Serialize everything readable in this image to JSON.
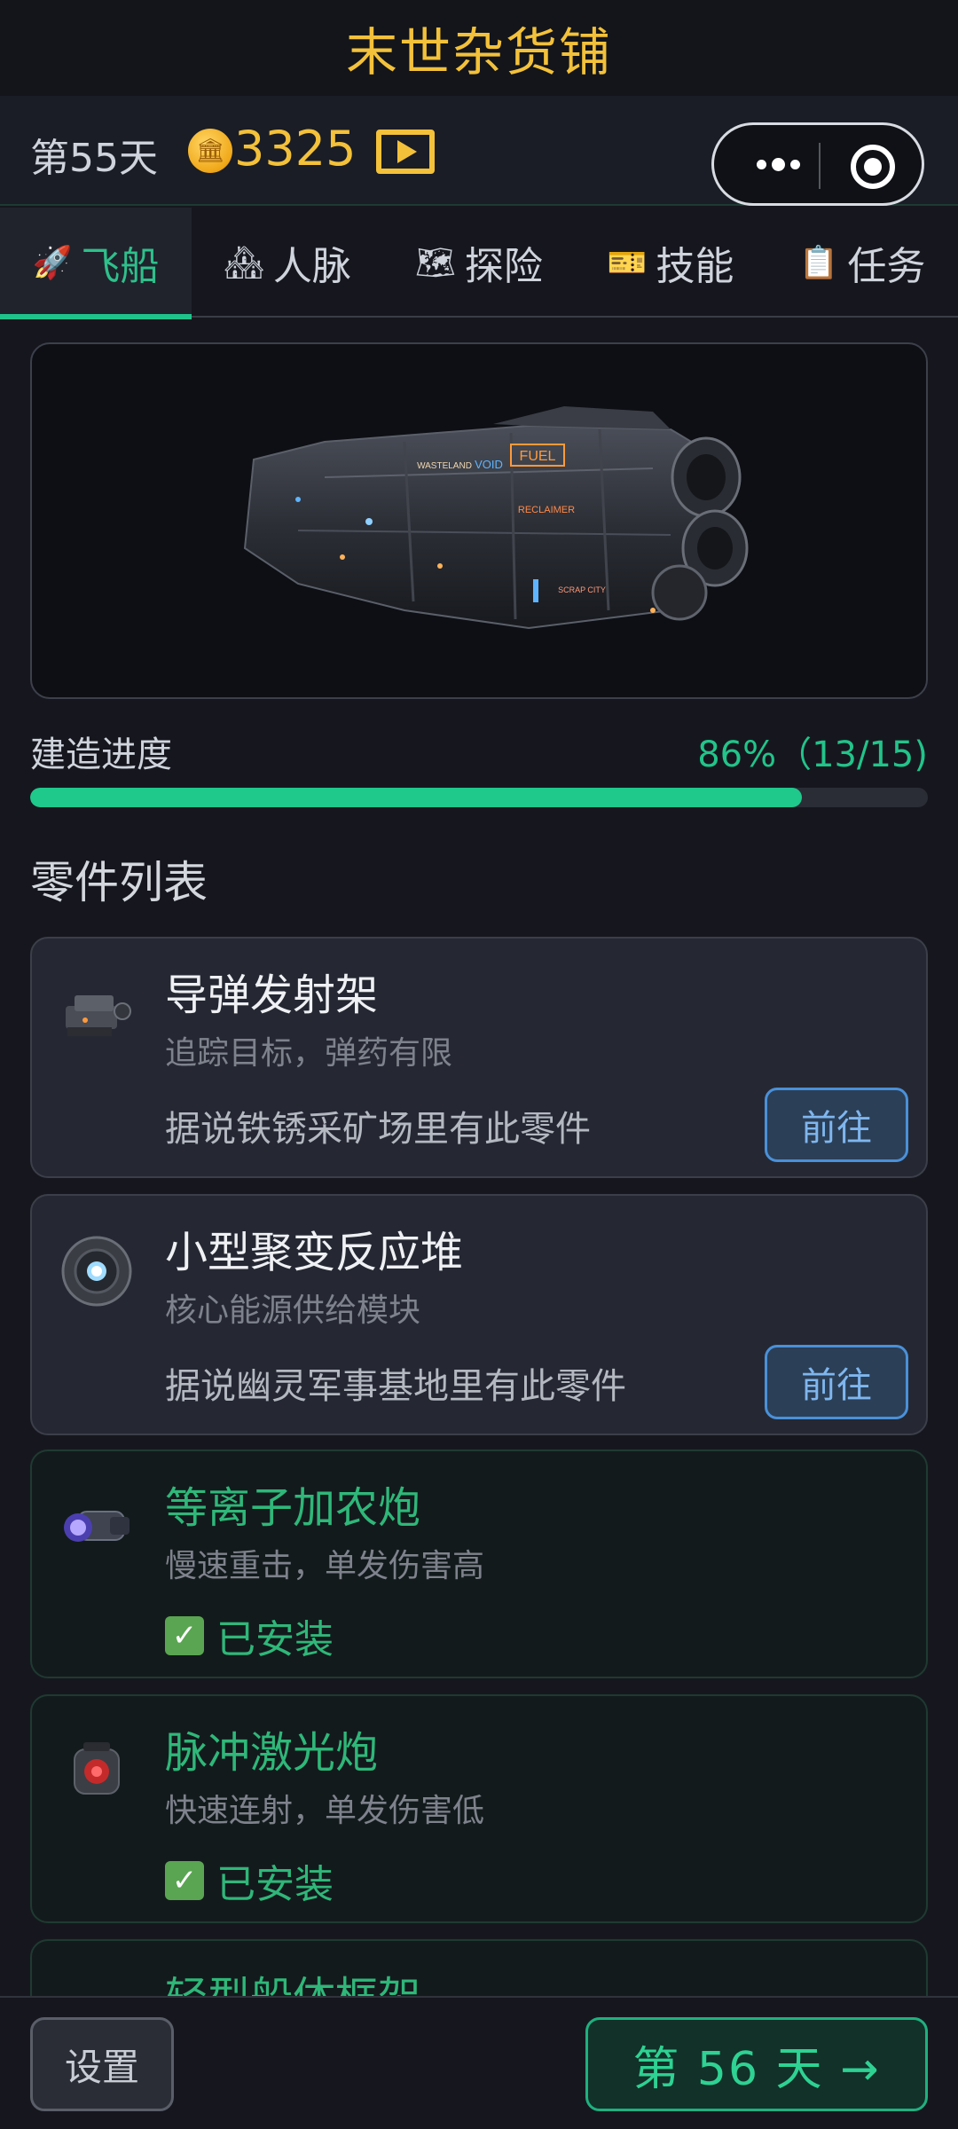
{
  "header": {
    "title": "末世杂货铺"
  },
  "status": {
    "day": "第55天",
    "coins": "3325",
    "coin_icon": "coin-icon",
    "video_icon": "video-play-icon"
  },
  "capsule": {
    "more_icon": "more-dots-icon",
    "close_icon": "target-close-icon"
  },
  "tabs": [
    {
      "icon": "🚀",
      "label": "飞船",
      "active": true
    },
    {
      "icon": "🏘",
      "label": "人脉",
      "active": false
    },
    {
      "icon": "🗺",
      "label": "探险",
      "active": false
    },
    {
      "icon": "🎫",
      "label": "技能",
      "active": false
    },
    {
      "icon": "📋",
      "label": "任务",
      "active": false
    }
  ],
  "ship": {
    "signs": [
      "FUEL",
      "WASTELAND",
      "VOID",
      "RECLAIMER",
      "SCRAP CITY"
    ]
  },
  "progress": {
    "label": "建造进度",
    "value_text": "86%（13/15)",
    "fraction": 0.86
  },
  "parts": {
    "section_title": "零件列表",
    "items": [
      {
        "name": "导弹发射架",
        "desc": "追踪目标，弹药有限",
        "hint": "据说铁锈采矿场里有此零件",
        "action": "前往",
        "installed": false
      },
      {
        "name": "小型聚变反应堆",
        "desc": "核心能源供给模块",
        "hint": "据说幽灵军事基地里有此零件",
        "action": "前往",
        "installed": false
      },
      {
        "name": "等离子加农炮",
        "desc": "慢速重击，单发伤害高",
        "status": "已安装",
        "installed": true
      },
      {
        "name": "脉冲激光炮",
        "desc": "快速连射，单发伤害低",
        "status": "已安装",
        "installed": true
      },
      {
        "name": "轻型船体框架",
        "installed": true
      }
    ]
  },
  "footer": {
    "settings": "设置",
    "next_day": "第 56 天 →"
  },
  "colors": {
    "accent": "#1ec98b",
    "gold": "#f3c13a",
    "link": "#4a90d9"
  }
}
